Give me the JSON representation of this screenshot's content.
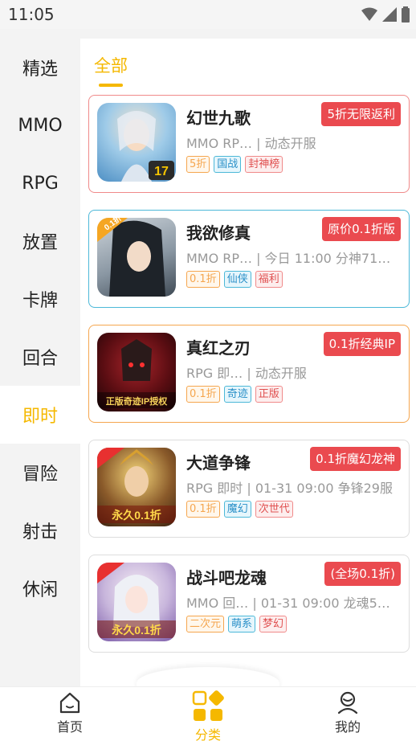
{
  "status_bar": {
    "time": "11:05"
  },
  "sidebar": {
    "items": [
      {
        "label": "精选",
        "active": false
      },
      {
        "label": "MMO",
        "active": false
      },
      {
        "label": "RPG",
        "active": false
      },
      {
        "label": "放置",
        "active": false
      },
      {
        "label": "卡牌",
        "active": false
      },
      {
        "label": "回合",
        "active": false
      },
      {
        "label": "即时",
        "active": true
      },
      {
        "label": "冒险",
        "active": false
      },
      {
        "label": "射击",
        "active": false
      },
      {
        "label": "休闲",
        "active": false
      }
    ]
  },
  "main": {
    "tab_label": "全部",
    "games": [
      {
        "title": "幻世九歌",
        "meta": "MMO  RP…  |  动态开服",
        "tags": [
          "5折",
          "国战",
          "封神榜"
        ],
        "promo": "5折无限返利",
        "badge": "17"
      },
      {
        "title": "我欲修真",
        "meta": "MMO  RP…  |  今日 11:00 分神71…",
        "tags": [
          "0.1折",
          "仙侠",
          "福利"
        ],
        "promo": "原价0.1折版",
        "badge": "0.1折"
      },
      {
        "title": "真红之刃",
        "meta": "RPG  即…  |  动态开服",
        "tags": [
          "0.1折",
          "奇迹",
          "正版"
        ],
        "promo": "0.1折经典IP",
        "badge": "正版奇迹IP授权"
      },
      {
        "title": "大道争锋",
        "meta": "RPG  即时  |  01-31 09:00 争锋29服",
        "tags": [
          "0.1折",
          "魔幻",
          "次世代"
        ],
        "promo": "0.1折魔幻龙神",
        "badge": "永久0.1折"
      },
      {
        "title": "战斗吧龙魂",
        "meta": "MMO  回…  |  01-31 09:00 龙魂5…",
        "tags": [
          "二次元",
          "萌系",
          "梦幻"
        ],
        "promo": "(全场0.1折)",
        "badge": "永久0.1折"
      }
    ]
  },
  "bottom_nav": {
    "items": [
      {
        "label": "首页",
        "icon": "home-icon",
        "active": false
      },
      {
        "label": "分类",
        "icon": "category-icon",
        "active": true
      },
      {
        "label": "我的",
        "icon": "profile-icon",
        "active": false
      }
    ]
  },
  "colors": {
    "accent": "#f5b800",
    "promo": "#ea4a4f",
    "sidebar_bg": "#f3f3f3"
  }
}
